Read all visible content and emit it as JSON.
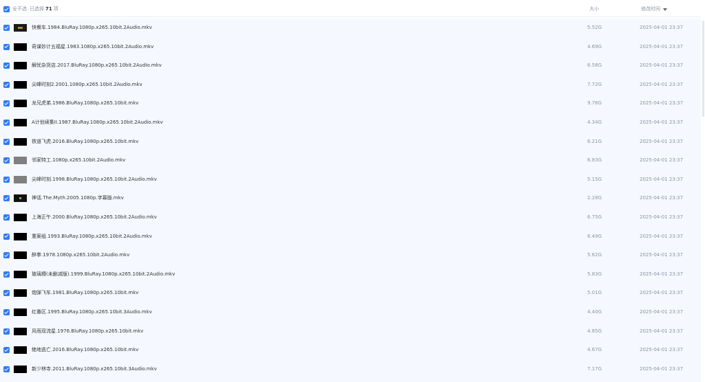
{
  "header": {
    "select_all_label": "全不选",
    "selected_prefix": "已选择",
    "selected_count": "71",
    "selected_suffix": "项",
    "col_size": "大小",
    "col_date": "修改时间"
  },
  "files": [
    {
      "name": "快餐车.1984.BluRay.1080p.x265.10bit.2Audio.mkv",
      "size": "5.52G",
      "date": "2025-04-01 23:37",
      "thumb": "poster2"
    },
    {
      "name": "奇谋妙计五福星.1983.1080p.x265.10bit.2Audio.mkv",
      "size": "4.69G",
      "date": "2025-04-01 23:37",
      "thumb": "black"
    },
    {
      "name": "解忧杂货店.2017.BluRay.1080p.x265.10bit.2Audio.mkv",
      "size": "6.58G",
      "date": "2025-04-01 23:37",
      "thumb": "black"
    },
    {
      "name": "尖峰时刻2.2001.1080p.x265.10bit.2Audio.mkv",
      "size": "7.72G",
      "date": "2025-04-01 23:37",
      "thumb": "black"
    },
    {
      "name": "龙兄虎弟.1986.BluRay.1080p.x265.10bit.mkv",
      "size": "9.76G",
      "date": "2025-04-01 23:37",
      "thumb": "black"
    },
    {
      "name": "A计划续集II.1987.BluRay.1080p.x265.10bit.2Audio.mkv",
      "size": "4.34G",
      "date": "2025-04-01 23:37",
      "thumb": "black"
    },
    {
      "name": "铁道飞虎.2016.BluRay.1080p.x265.10bit.mkv",
      "size": "6.21G",
      "date": "2025-04-01 23:37",
      "thumb": "black"
    },
    {
      "name": "邻家特工.1080p.x265.10bit.2Audio.mkv",
      "size": "6.83G",
      "date": "2025-04-01 23:37",
      "thumb": "gray"
    },
    {
      "name": "尖峰时刻.1998.BluRay.1080p.x265.10bit.2Audio.mkv",
      "size": "5.15G",
      "date": "2025-04-01 23:37",
      "thumb": "gray"
    },
    {
      "name": "神话.The.Myth.2005.1080p.字幕版.mkv",
      "size": "2.28G",
      "date": "2025-04-01 23:37",
      "thumb": "poster"
    },
    {
      "name": "上海正午.2000.BluRay.1080p.x265.10bit.2Audio.mkv",
      "size": "6.75G",
      "date": "2025-04-01 23:37",
      "thumb": "black"
    },
    {
      "name": "重案组.1993.BluRay.1080p.x265.10bit.2Audio.mkv",
      "size": "6.49G",
      "date": "2025-04-01 23:37",
      "thumb": "black"
    },
    {
      "name": "醉拳.1978.1080p.x265.10bit.2Audio.mkv",
      "size": "5.62G",
      "date": "2025-04-01 23:37",
      "thumb": "black"
    },
    {
      "name": "玻璃樽(未删减版).1999.BluRay.1080p.x265.10bit.2Audio.mkv",
      "size": "5.83G",
      "date": "2025-04-01 23:37",
      "thumb": "black"
    },
    {
      "name": "炮弹飞车.1981.BluRay.1080p.x265.10bit.mkv",
      "size": "5.01G",
      "date": "2025-04-01 23:37",
      "thumb": "black"
    },
    {
      "name": "红番区.1995.BluRay.1080p.x265.10bit.3Audio.mkv",
      "size": "4.40G",
      "date": "2025-04-01 23:37",
      "thumb": "black"
    },
    {
      "name": "风雨双流星.1976.BluRay.1080p.x265.10bit.mkv",
      "size": "4.85G",
      "date": "2025-04-01 23:37",
      "thumb": "black"
    },
    {
      "name": "绝地逃亡.2016.BluRay.1080p.x265.10bit.mkv",
      "size": "4.67G",
      "date": "2025-04-01 23:37",
      "thumb": "black"
    },
    {
      "name": "新少林寺.2011.BluRay.1080p.x265.10bit.3Audio.mkv",
      "size": "7.17G",
      "date": "2025-04-01 23:37",
      "thumb": "black"
    }
  ]
}
